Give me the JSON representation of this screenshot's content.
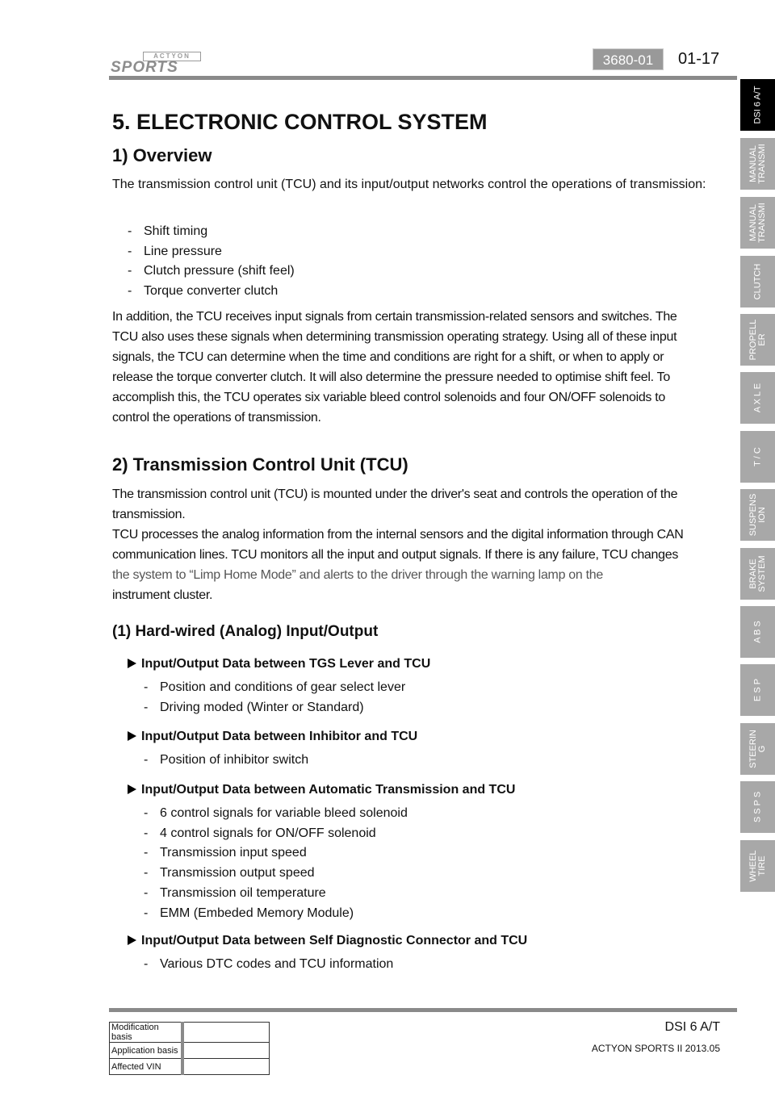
{
  "header": {
    "logo_top": "ACTYON",
    "logo_main": "SPORTS",
    "section_code": "3680-01",
    "page_number": "01-17"
  },
  "side_tabs": [
    {
      "label": "DSI 6 A/T",
      "active": true
    },
    {
      "label": "MANUAL\nTRANSMI",
      "active": false
    },
    {
      "label": "MANUAL\nTRANSMI",
      "active": false
    },
    {
      "label": "CLUTCH",
      "active": false
    },
    {
      "label": "PROPELL\nER",
      "active": false
    },
    {
      "label": "A X L E",
      "active": false
    },
    {
      "label": "T / C",
      "active": false
    },
    {
      "label": "SUSPENS\nION",
      "active": false
    },
    {
      "label": "BRAKE\nSYSTEM",
      "active": false
    },
    {
      "label": "A B S",
      "active": false
    },
    {
      "label": "E S P",
      "active": false
    },
    {
      "label": "STEERIN\nG",
      "active": false
    },
    {
      "label": "S S P S",
      "active": false
    },
    {
      "label": "WHEEL\nTIRE",
      "active": false
    }
  ],
  "content": {
    "title": "5. ELECTRONIC CONTROL SYSTEM",
    "overview": {
      "heading": "1) Overview",
      "intro": "The transmission control unit (TCU) and its input/output networks control the operations of transmission:",
      "items": [
        "Shift timing",
        "Line pressure",
        "Clutch pressure (shift feel)",
        "Torque converter clutch"
      ],
      "para_lines": [
        "In addition, the TCU receives input signals from certain transmission-related sensors and switches. The",
        "TCU also uses these signals when determining transmission operating strategy. Using all of these input",
        "signals, the TCU can determine when the time and conditions are right for a shift, or when to apply or",
        "release the torque converter clutch. It will also determine the pressure needed to optimise shift feel. To",
        "accomplish this, the TCU operates six variable bleed control solenoids and four ON/OFF solenoids to",
        "control the operations of transmission."
      ]
    },
    "tcu": {
      "heading": "2) Transmission Control Unit (TCU)",
      "para_lines": [
        "The transmission control unit (TCU) is mounted under the driver's seat and controls the operation of the",
        "transmission.",
        "TCU processes the analog information from the internal sensors and the digital information through CAN",
        "communication lines. TCU monitors all the input and output signals. If there is any failure, TCU changes",
        "the system to “Limp Home Mode” and alerts to the driver through the warning lamp on the",
        "instrument cluster."
      ]
    },
    "hardwired": {
      "heading": "(1) Hard-wired (Analog) Input/Output",
      "groups": [
        {
          "title": "Input/Output Data between TGS Lever and TCU",
          "items": [
            "Position and conditions of gear select lever",
            "Driving moded (Winter or Standard)"
          ]
        },
        {
          "title": "Input/Output Data between Inhibitor and TCU",
          "items": [
            "Position of inhibitor switch"
          ]
        },
        {
          "title": "Input/Output Data between Automatic Transmission and TCU",
          "items": [
            "6 control signals for variable bleed solenoid",
            "4 control signals for ON/OFF solenoid",
            "Transmission input speed",
            "Transmission output speed",
            "Transmission oil temperature",
            "EMM (Embeded Memory Module)"
          ]
        },
        {
          "title": "Input/Output Data between Self Diagnostic Connector and TCU",
          "items": [
            "Various DTC codes and TCU information"
          ]
        }
      ]
    }
  },
  "footer": {
    "table": [
      {
        "label": "Modification basis",
        "value": ""
      },
      {
        "label": "Application basis",
        "value": ""
      },
      {
        "label": "Affected VIN",
        "value": ""
      }
    ],
    "title": "DSI 6 A/T",
    "subtitle": "ACTYON SPORTS II 2013.05"
  }
}
